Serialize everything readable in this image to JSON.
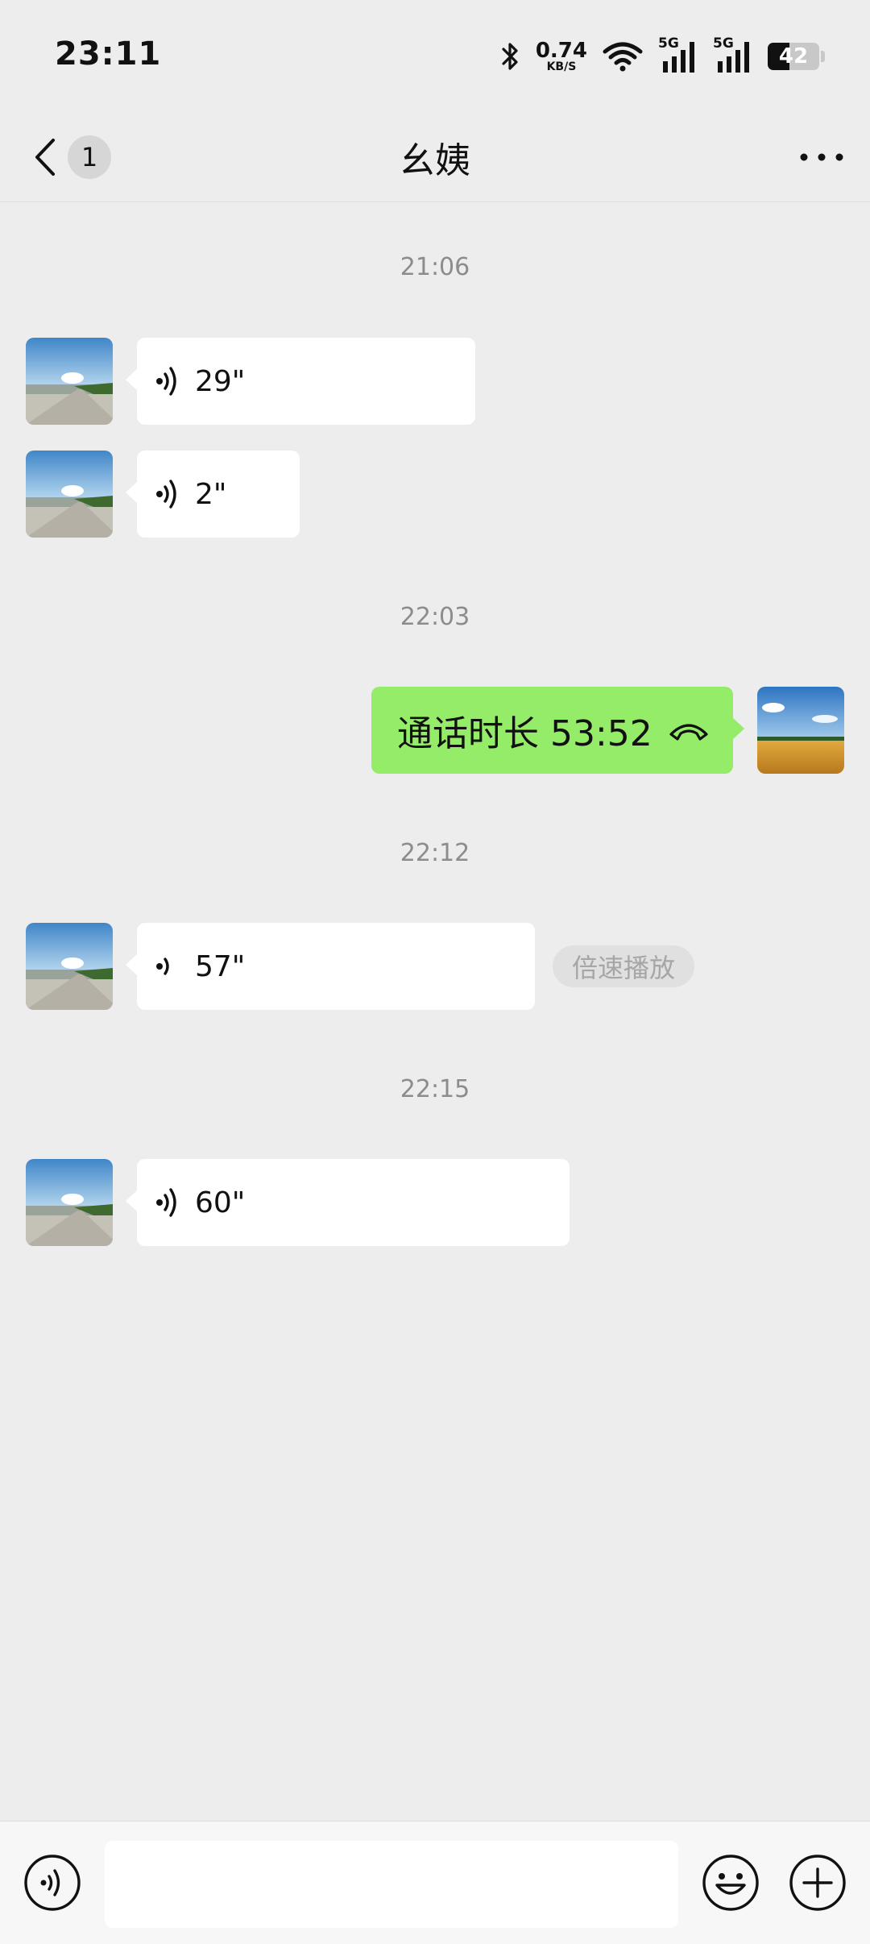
{
  "status_bar": {
    "time": "23:11",
    "net_speed_value": "0.74",
    "net_speed_unit": "KB/S",
    "signal_1_label": "5G",
    "signal_2_label": "5G",
    "battery_level": "42",
    "battery_fraction": 0.42
  },
  "header": {
    "unread_count": "1",
    "title": "幺姨"
  },
  "messages": {
    "ts1": "21:06",
    "voice1_duration": "29\"",
    "voice2_duration": "2\"",
    "ts2": "22:03",
    "call_text": "通话时长 53:52",
    "ts3": "22:12",
    "voice3_duration": "57\"",
    "speed_play_label": "倍速播放",
    "ts4": "22:15",
    "voice4_duration": "60\""
  },
  "colors": {
    "background": "#ededed",
    "sent_bubble": "#95ec69",
    "received_bubble": "#ffffff"
  }
}
